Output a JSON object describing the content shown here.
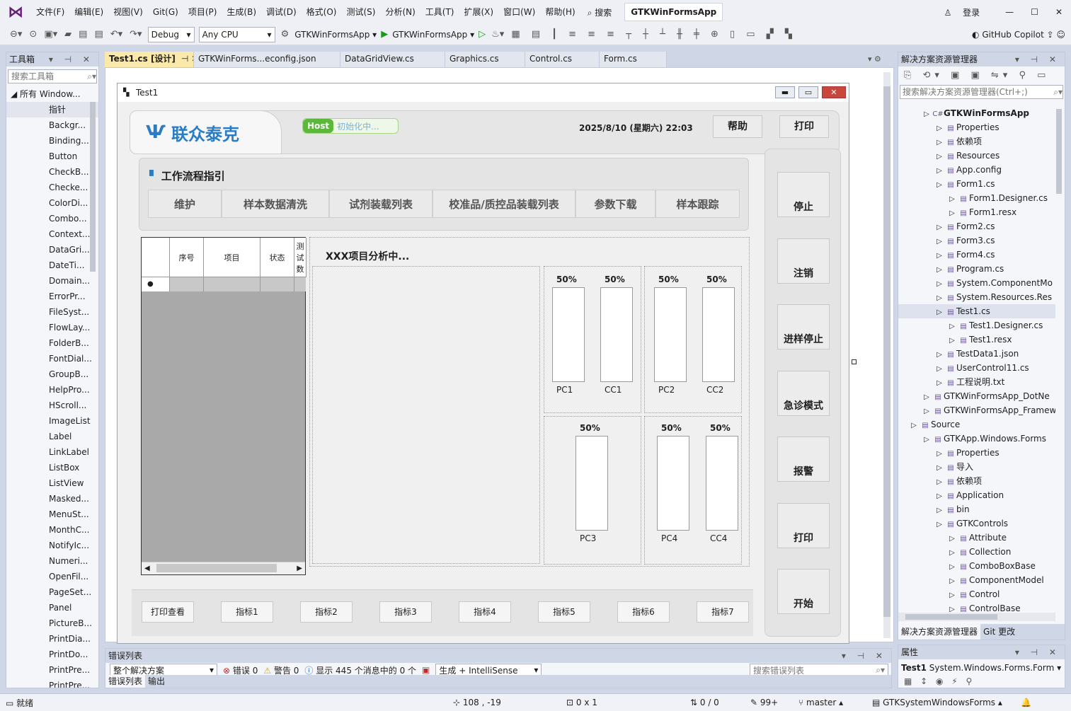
{
  "menu": {
    "items": [
      "文件(F)",
      "编辑(E)",
      "视图(V)",
      "Git(G)",
      "项目(P)",
      "生成(B)",
      "调试(D)",
      "格式(O)",
      "测试(S)",
      "分析(N)",
      "工具(T)",
      "扩展(X)",
      "窗口(W)",
      "帮助(H)"
    ],
    "search": "搜索",
    "solution_title": "GTKWinFormsApp",
    "login": "登录"
  },
  "toolbar": {
    "config": "Debug",
    "platform": "Any CPU",
    "startup_project": "GTKWinFormsApp",
    "run_target": "GTKWinFormsApp",
    "copilot": "GitHub Copilot"
  },
  "toolbox": {
    "title": "工具箱",
    "search_placeholder": "搜索工具箱",
    "group": "所有 Window...",
    "items": [
      "指针",
      "Backgr...",
      "Binding...",
      "Button",
      "CheckB...",
      "Checke...",
      "ColorDi...",
      "Combo...",
      "Context...",
      "DataGri...",
      "DateTi...",
      "Domain...",
      "ErrorPr...",
      "FileSyst...",
      "FlowLay...",
      "FolderB...",
      "FontDial...",
      "GroupB...",
      "HelpPro...",
      "HScroll...",
      "ImageList",
      "Label",
      "LinkLabel",
      "ListBox",
      "ListView",
      "Masked...",
      "MenuSt...",
      "MonthC...",
      "NotifyIc...",
      "Numeri...",
      "OpenFil...",
      "PageSet...",
      "Panel",
      "PictureB...",
      "PrintDia...",
      "PrintDo...",
      "PrintPre...",
      "PrintPre..."
    ]
  },
  "tabs": [
    "Test1.cs [设计]",
    "GTKWinForms...econfig.json",
    "DataGridView.cs",
    "Graphics.cs",
    "Control.cs",
    "Form.cs"
  ],
  "form": {
    "title": "Test1",
    "logo_text": "联众泰克",
    "host_label": "Host",
    "host_status": "初始化中...",
    "datetime": "2025/8/10 (星期六) 22:03",
    "help_button": "帮助",
    "print_button": "打印",
    "workflow_title": "工作流程指引",
    "workflow_tabs": [
      "维护",
      "样本数据清洗",
      "试剂装载列表",
      "校准品/质控品装载列表",
      "参数下载",
      "样本跟踪"
    ],
    "grid_columns": [
      "序号",
      "项目",
      "状态",
      "测试数"
    ],
    "analysis_label": "XXX项目分析中...",
    "tubes_top": [
      {
        "pct": "50%",
        "name": "PC1"
      },
      {
        "pct": "50%",
        "name": "CC1"
      },
      {
        "pct": "50%",
        "name": "PC2"
      },
      {
        "pct": "50%",
        "name": "CC2"
      }
    ],
    "tubes_bottom": [
      {
        "pct": "50%",
        "name": "PC3"
      },
      {
        "pct": "50%",
        "name": "PC4"
      },
      {
        "pct": "50%",
        "name": "CC4"
      }
    ],
    "side_buttons": [
      "停止",
      "注销",
      "进样停止",
      "急诊模式",
      "报警",
      "打印",
      "开始"
    ],
    "bottom_buttons": [
      "打印查看",
      "指标1",
      "指标2",
      "指标3",
      "指标4",
      "指标5",
      "指标6",
      "指标7"
    ]
  },
  "solution_explorer": {
    "title": "解决方案资源管理器",
    "search_placeholder": "搜索解决方案资源管理器(Ctrl+;)",
    "tree": [
      {
        "level": 1,
        "label": "GTKWinFormsApp",
        "bold": true,
        "icon": "C#"
      },
      {
        "level": 2,
        "label": "Properties"
      },
      {
        "level": 2,
        "label": "依赖项"
      },
      {
        "level": 2,
        "label": "Resources"
      },
      {
        "level": 2,
        "label": "App.config"
      },
      {
        "level": 2,
        "label": "Form1.cs"
      },
      {
        "level": 3,
        "label": "Form1.Designer.cs"
      },
      {
        "level": 3,
        "label": "Form1.resx"
      },
      {
        "level": 2,
        "label": "Form2.cs"
      },
      {
        "level": 2,
        "label": "Form3.cs"
      },
      {
        "level": 2,
        "label": "Form4.cs"
      },
      {
        "level": 2,
        "label": "Program.cs"
      },
      {
        "level": 2,
        "label": "System.ComponentMo"
      },
      {
        "level": 2,
        "label": "System.Resources.Res"
      },
      {
        "level": 2,
        "label": "Test1.cs",
        "selected": true
      },
      {
        "level": 3,
        "label": "Test1.Designer.cs"
      },
      {
        "level": 3,
        "label": "Test1.resx"
      },
      {
        "level": 2,
        "label": "TestData1.json"
      },
      {
        "level": 2,
        "label": "UserControl11.cs"
      },
      {
        "level": 2,
        "label": "工程说明.txt"
      },
      {
        "level": 1,
        "label": "GTKWinFormsApp_DotNe"
      },
      {
        "level": 1,
        "label": "GTKWinFormsApp_Framew"
      },
      {
        "level": 0,
        "label": "Source"
      },
      {
        "level": 1,
        "label": "GTKApp.Windows.Forms"
      },
      {
        "level": 2,
        "label": "Properties"
      },
      {
        "level": 2,
        "label": "导入"
      },
      {
        "level": 2,
        "label": "依赖项"
      },
      {
        "level": 2,
        "label": "Application"
      },
      {
        "level": 2,
        "label": "bin"
      },
      {
        "level": 2,
        "label": "GTKControls"
      },
      {
        "level": 3,
        "label": "Attribute"
      },
      {
        "level": 3,
        "label": "Collection"
      },
      {
        "level": 3,
        "label": "ComboBoxBase"
      },
      {
        "level": 3,
        "label": "ComponentModel"
      },
      {
        "level": 3,
        "label": "Control"
      },
      {
        "level": 3,
        "label": "ControlBase"
      }
    ],
    "bottom_tabs": [
      "解决方案资源管理器",
      "Git 更改"
    ]
  },
  "properties": {
    "title": "属性",
    "object": "Test1",
    "type": "System.Windows.Forms.Form"
  },
  "error_list": {
    "title": "错误列表",
    "scope": "整个解决方案",
    "errors": "错误 0",
    "warnings": "警告 0",
    "messages": "显示 445 个消息中的 0 个",
    "build": "生成 + IntelliSense",
    "search_placeholder": "搜索错误列表",
    "tabs": [
      "错误列表",
      "输出"
    ]
  },
  "status": {
    "ready": "就绪",
    "position": "108 , -19",
    "size": "0 x 1",
    "changes": "0 / 0",
    "commits": "99+",
    "branch": "master",
    "repo": "GTKSystemWindowsForms"
  }
}
